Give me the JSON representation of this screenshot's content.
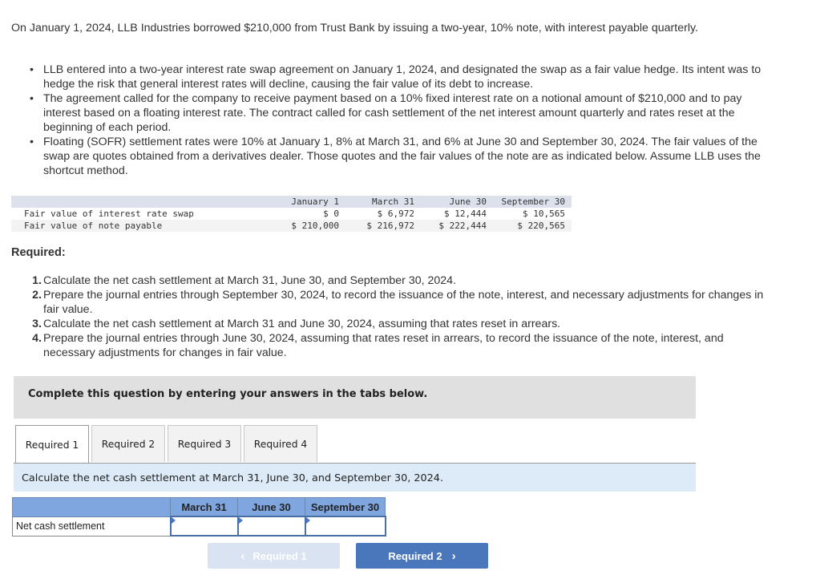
{
  "problem": {
    "intro": "On January 1, 2024, LLB Industries borrowed $210,000 from Trust Bank by issuing a two-year, 10% note, with interest payable quarterly.",
    "bullets": [
      "LLB entered into a two-year interest rate swap agreement on January 1, 2024, and designated the swap as a fair value hedge. Its intent was to hedge the risk that general interest rates will decline, causing the fair value of its debt to increase.",
      "The agreement called for the company to receive payment based on a 10% fixed interest rate on a notional amount of $210,000 and to pay interest based on a floating interest rate. The contract called for cash settlement of the net interest amount quarterly and rates reset at the beginning of each period.",
      "Floating (SOFR) settlement rates were 10% at January 1, 8% at March 31, and 6% at June 30 and September 30, 2024. The fair values of the swap are quotes obtained from a derivatives dealer. Those quotes and the fair values of the note are as indicated below. Assume LLB uses the shortcut method."
    ],
    "bullet_glyph": "•"
  },
  "fair_value_table": {
    "columns": [
      "January 1",
      "March 31",
      "June 30",
      "September 30"
    ],
    "rows": [
      {
        "label": "Fair value of interest rate swap",
        "values": [
          "$ 0",
          "$ 6,972",
          "$ 12,444",
          "$ 10,565"
        ]
      },
      {
        "label": "Fair value of note payable",
        "values": [
          "$ 210,000",
          "$ 216,972",
          "$ 222,444",
          "$ 220,565"
        ]
      }
    ]
  },
  "required": {
    "title": "Required:",
    "items": [
      {
        "num": "1.",
        "text": "Calculate the net cash settlement at March 31, June 30, and September 30, 2024."
      },
      {
        "num": "2.",
        "text": "Prepare the journal entries through September 30, 2024, to record the issuance of the note, interest, and necessary adjustments for changes in fair value."
      },
      {
        "num": "3.",
        "text": "Calculate the net cash settlement at March 31 and June 30, 2024, assuming that rates reset in arrears."
      },
      {
        "num": "4.",
        "text": "Prepare the journal entries through June 30, 2024, assuming that rates reset in arrears, to record the issuance of the note, interest, and necessary adjustments for changes in fair value."
      }
    ]
  },
  "banner": {
    "text": "Complete this question by entering your answers in the tabs below."
  },
  "tabs": [
    {
      "label": "Required 1",
      "active": true
    },
    {
      "label": "Required 2",
      "active": false
    },
    {
      "label": "Required 3",
      "active": false
    },
    {
      "label": "Required 4",
      "active": false
    }
  ],
  "instruction": "Calculate the net cash settlement at March 31, June 30, and September 30, 2024.",
  "answer_table": {
    "columns": [
      "",
      "March 31",
      "June 30",
      "September 30"
    ],
    "rows": [
      {
        "label": "Net cash settlement",
        "values": [
          "",
          "",
          ""
        ]
      }
    ]
  },
  "nav": {
    "prev_label": "Required 1",
    "prev_icon": "‹",
    "prev_enabled": false,
    "next_label": "Required 2",
    "next_icon": "›",
    "next_enabled": true
  }
}
